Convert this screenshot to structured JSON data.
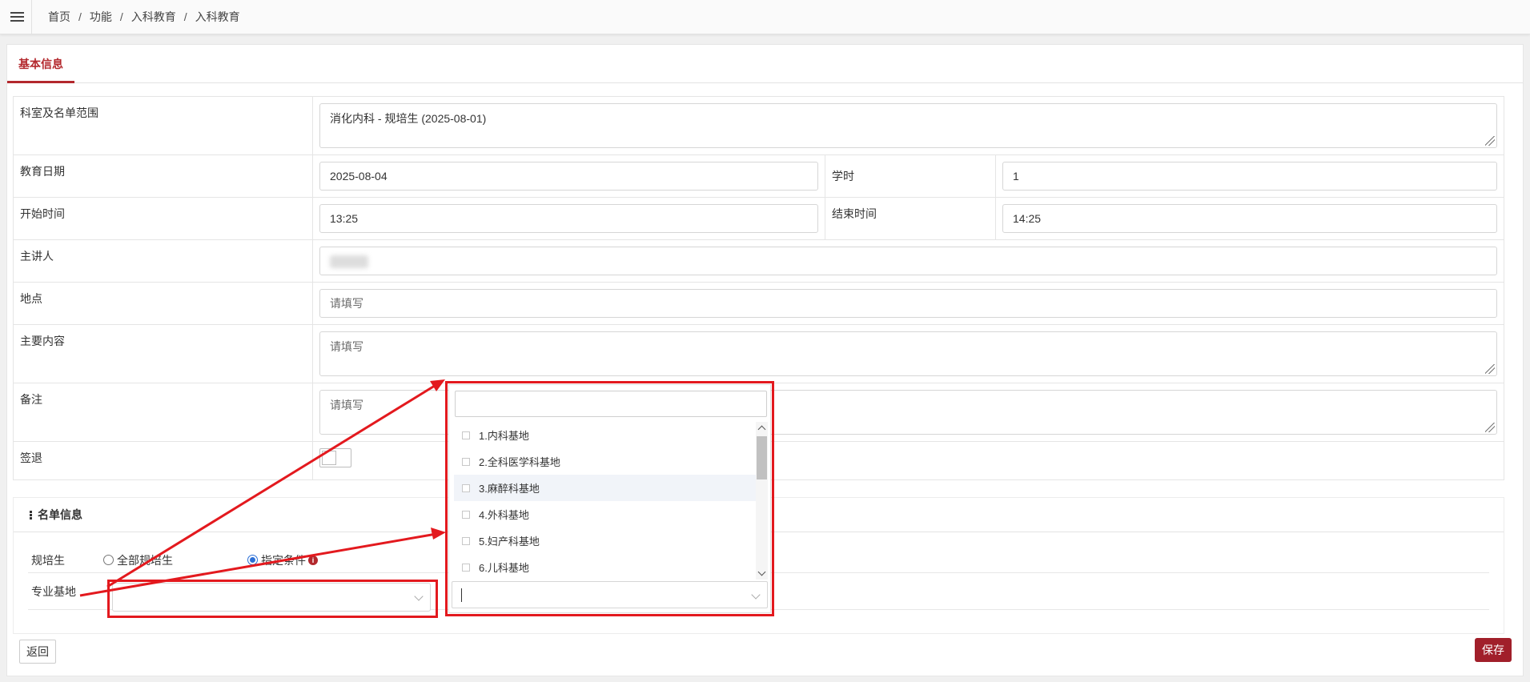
{
  "header": {
    "breadcrumb": [
      "首页",
      "功能",
      "入科教育",
      "入科教育"
    ],
    "separator": "/"
  },
  "tabs": {
    "active": "基本信息"
  },
  "form": {
    "dept_scope": {
      "label": "科室及名单范围",
      "value": "消化内科 - 规培生 (2025-08-01)"
    },
    "edu_date": {
      "label": "教育日期",
      "value": "2025-08-04"
    },
    "credit_hours": {
      "label": "学时",
      "value": "1"
    },
    "start_time": {
      "label": "开始时间",
      "value": "13:25"
    },
    "end_time": {
      "label": "结束时间",
      "value": "14:25"
    },
    "lecturer": {
      "label": "主讲人"
    },
    "location": {
      "label": "地点",
      "placeholder": "请填写"
    },
    "content": {
      "label": "主要内容",
      "placeholder": "请填写"
    },
    "remark": {
      "label": "备注",
      "placeholder": "请填写"
    },
    "sign_out": {
      "label": "签退"
    }
  },
  "roster": {
    "title": "名单信息",
    "trainee_label": "规培生",
    "radio_all": "全部规培生",
    "radio_specified": "指定条件",
    "selected_radio": "指定条件",
    "base_label": "专业基地"
  },
  "dropdown": {
    "items": [
      "1.内科基地",
      "2.全科医学科基地",
      "3.麻醉科基地",
      "4.外科基地",
      "5.妇产科基地",
      "6.儿科基地"
    ],
    "hovered_index": 2
  },
  "buttons": {
    "back": "返回",
    "save": "保存"
  },
  "colors": {
    "accent": "#b3282d",
    "save_bg": "#a11f2a",
    "highlight": "#e3191e",
    "radio": "#2b6fd6"
  }
}
